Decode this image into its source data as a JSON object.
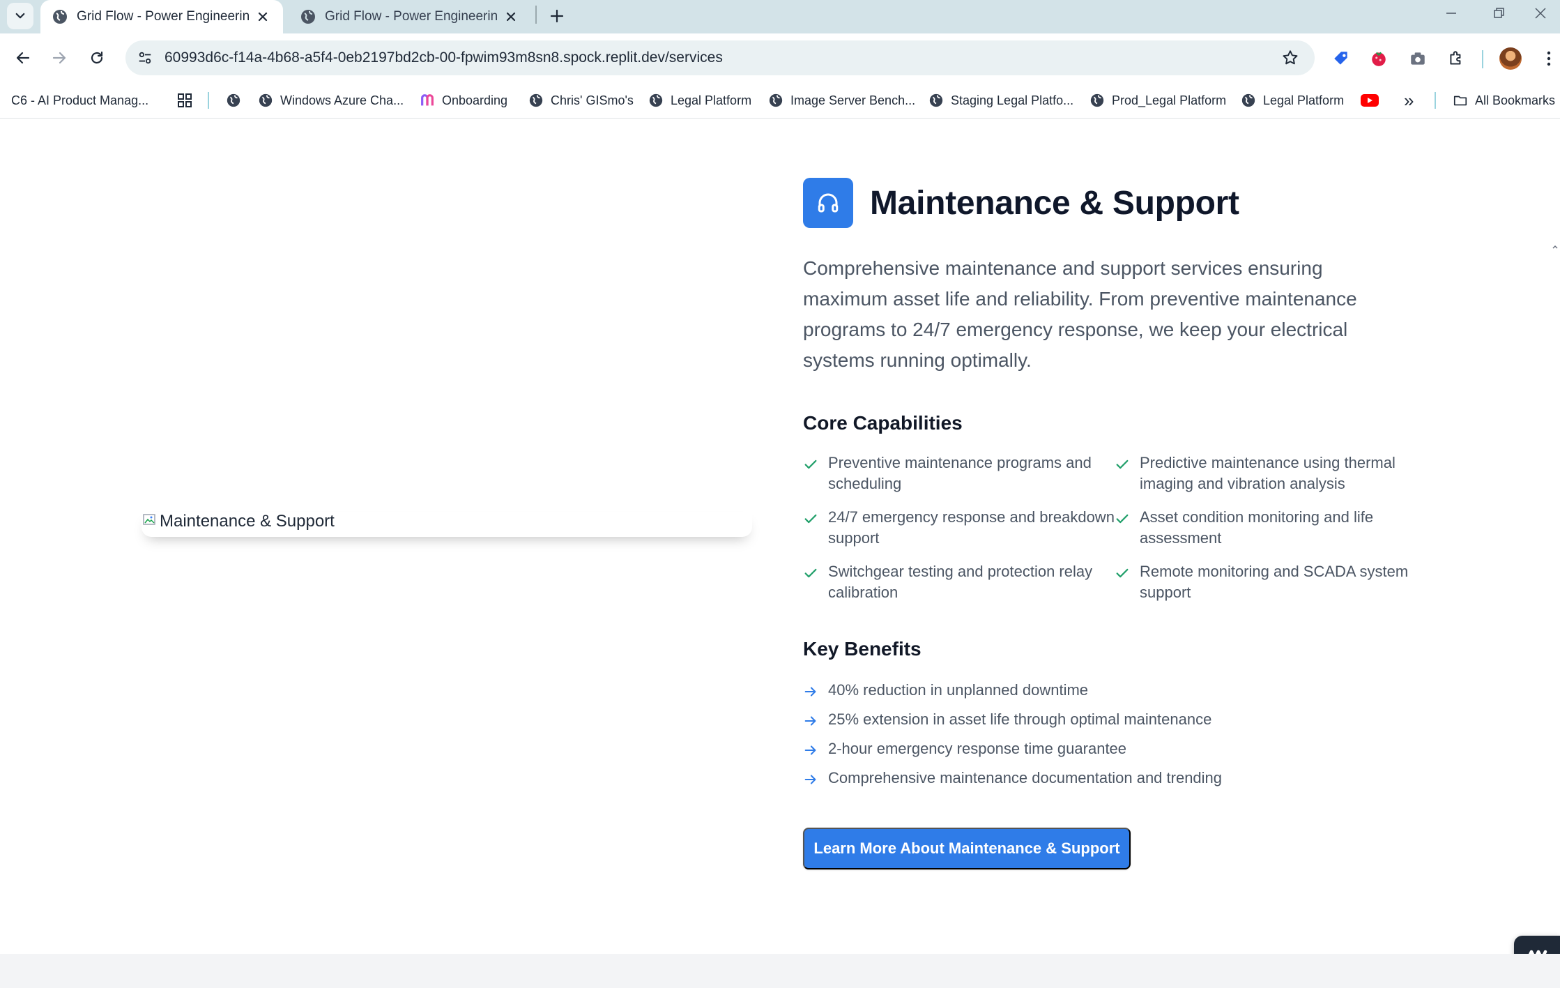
{
  "browser": {
    "tabs": [
      {
        "title": "Grid Flow - Power Engineering Services",
        "active": true
      },
      {
        "title": "Grid Flow - Power Engineering Services",
        "active": false
      }
    ],
    "url": "60993d6c-f14a-4b68-a5f4-0eb2197bd2cb-00-fpwim93m8sn8.spock.replit.dev/services",
    "bookmarks": {
      "first": "C6 - AI Product Manag...",
      "items": [
        "Windows Azure Cha...",
        "Onboarding",
        "Chris' GISmo's",
        "Legal Platform",
        "Image Server Bench...",
        "Staging Legal Platfo...",
        "Prod_Legal Platform",
        "Legal Platform"
      ],
      "all_bookmarks": "All Bookmarks",
      "overflow": "»"
    },
    "icons": {
      "tab_menu": "chevron-down-icon",
      "new_tab": "plus-icon",
      "back": "arrow-left-icon",
      "forward": "arrow-right-icon",
      "reload": "reload-icon",
      "site_info": "tune-icon",
      "bookmark_star": "star-icon",
      "extensions": "puzzle-icon",
      "menu": "kebab-icon"
    }
  },
  "service": {
    "image_alt": "Maintenance & Support",
    "title": "Maintenance & Support",
    "icon": "headphones-icon",
    "description": "Comprehensive maintenance and support services ensuring maximum asset life and reliability. From preventive maintenance programs to 24/7 emergency response, we keep your electrical systems running optimally.",
    "capabilities_heading": "Core Capabilities",
    "capabilities": [
      "Preventive maintenance programs and scheduling",
      "Predictive maintenance using thermal imaging and vibration analysis",
      "24/7 emergency response and breakdown support",
      "Asset condition monitoring and life assessment",
      "Switchgear testing and protection relay calibration",
      "Remote monitoring and SCADA system support"
    ],
    "benefits_heading": "Key Benefits",
    "benefits": [
      "40% reduction in unplanned downtime",
      "25% extension in asset life through optimal maintenance",
      "2-hour emergency response time guarantee",
      "Comprehensive maintenance documentation and trending"
    ],
    "cta_label": "Learn More About Maintenance & Support"
  },
  "colors": {
    "accent": "#2f7ce8",
    "check": "#22a06b",
    "arrow": "#2f7ce8",
    "tabstrip": "#d3e3e8"
  }
}
